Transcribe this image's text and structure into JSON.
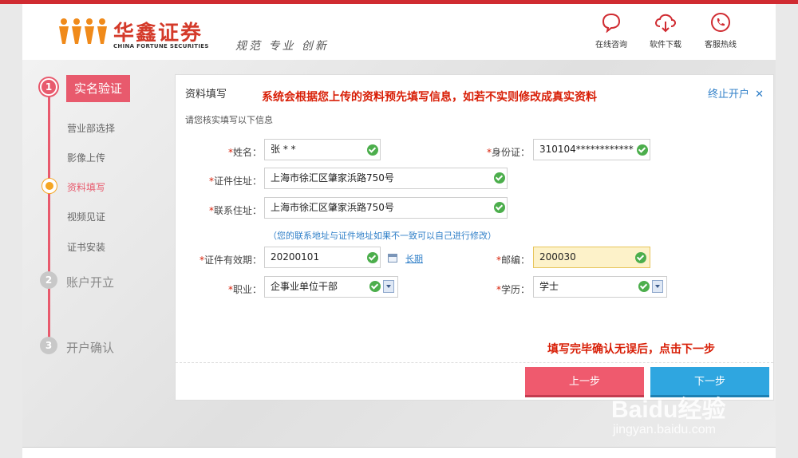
{
  "brand": {
    "name_cn": "华鑫证券",
    "name_en": "CHINA FORTUNE SECURITIES",
    "slogan": "规范 专业 创新",
    "accent_color": "#d02b31"
  },
  "header_links": [
    {
      "label": "在线咨询",
      "icon": "chat-bubble-icon"
    },
    {
      "label": "软件下载",
      "icon": "cloud-download-icon"
    },
    {
      "label": "客服热线",
      "icon": "phone-icon"
    }
  ],
  "steps": [
    {
      "num": "1",
      "title": "实名验证",
      "active": true,
      "subitems": [
        "营业部选择",
        "影像上传",
        "资料填写",
        "视频见证",
        "证书安装"
      ],
      "current_sub": "资料填写"
    },
    {
      "num": "2",
      "title": "账户开立",
      "active": false
    },
    {
      "num": "3",
      "title": "开户确认",
      "active": false
    }
  ],
  "panel": {
    "title": "资料填写",
    "subtitle": "请您核实填写以下信息",
    "stop_link": "终止开户",
    "address_hint": "（您的联系地址与证件地址如果不一致可以自己进行修改）"
  },
  "annotations": {
    "top": "系统会根据您上传的资料预先填写信息，如若不实则修改成真实资料",
    "bottom": "填写完毕确认无误后，点击下一步"
  },
  "form": {
    "name_label": "姓名：",
    "name_value": "张 * *",
    "id_label": "身份证：",
    "id_value": "310104************",
    "id_address_label": "证件住址：",
    "id_address_value": "上海市徐汇区肇家浜路750号",
    "contact_address_label": "联系住址：",
    "contact_address_value": "上海市徐汇区肇家浜路750号",
    "validity_label": "证件有效期：",
    "validity_value": "20200101",
    "longterm_link": "长期",
    "postcode_label": "邮编：",
    "postcode_value": "200030",
    "job_label": "职业：",
    "job_value": "企事业单位干部",
    "edu_label": "学历：",
    "edu_value": "学士"
  },
  "buttons": {
    "prev": "上一步",
    "next": "下一步"
  },
  "watermark": {
    "logo": "Baidu经验",
    "url": "jingyan.baidu.com"
  }
}
